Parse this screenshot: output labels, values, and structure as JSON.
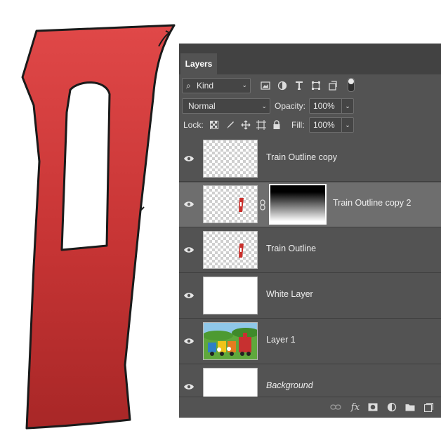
{
  "panel": {
    "tab_label": "Layers",
    "filter": {
      "kind_label": "Kind",
      "filter_toggle": "on"
    },
    "blend_mode": "Normal",
    "opacity_label": "Opacity:",
    "opacity_value": "100%",
    "lock_label": "Lock:",
    "fill_label": "Fill:",
    "fill_value": "100%"
  },
  "layers": [
    {
      "name": "Train Outline copy",
      "thumbnail": "transparent",
      "visible": true,
      "selected": false
    },
    {
      "name": "Train Outline copy 2",
      "thumbnail": "red-shape-on-transparent",
      "has_mask": true,
      "visible": true,
      "selected": true
    },
    {
      "name": "Train Outline",
      "thumbnail": "red-shape-on-transparent",
      "visible": true,
      "selected": false
    },
    {
      "name": "White Layer",
      "thumbnail": "white",
      "visible": true,
      "selected": false
    },
    {
      "name": "Layer 1",
      "thumbnail": "train-illustration",
      "visible": true,
      "selected": false
    },
    {
      "name": "Background",
      "thumbnail": "white",
      "visible": true,
      "selected": false,
      "italic": true
    }
  ],
  "colors": {
    "panel_bg": "#535353",
    "tab_bar_bg": "#424242",
    "selected_row": "#6e6e6e",
    "artwork_red": "#d43b3b",
    "artwork_red_dark": "#b02a2a",
    "outline": "#1a1a1a"
  }
}
